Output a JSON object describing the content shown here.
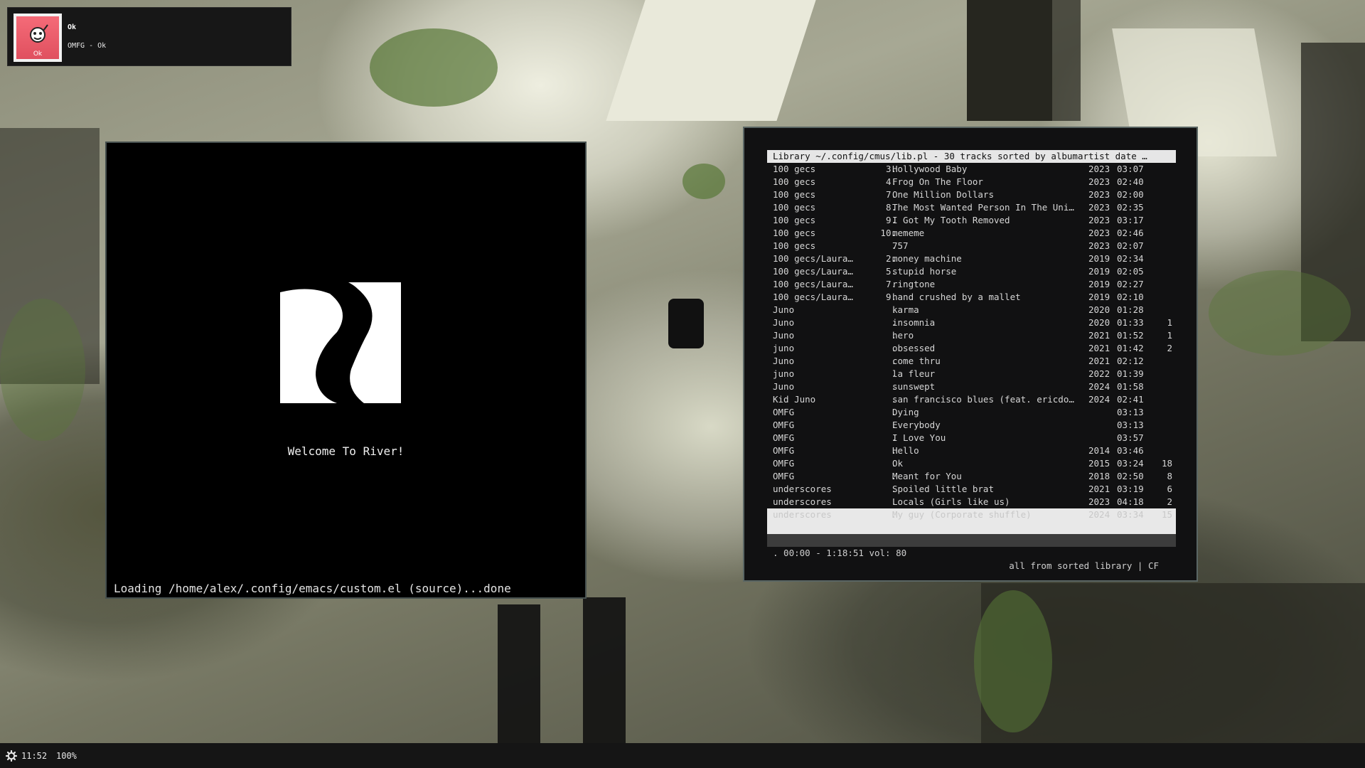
{
  "notification": {
    "icon": "album-cover-icon",
    "cover_text": "Ok",
    "title": "Ok",
    "body": "OMFG - Ok"
  },
  "emacs": {
    "logo": "river-logo-icon",
    "welcome": "Welcome To River!",
    "echo_area": "Loading /home/alex/.config/emacs/custom.el (source)...done"
  },
  "cmus": {
    "title": "Library ~/.config/cmus/lib.pl - 30 tracks sorted by albumartist date …",
    "tracks": [
      {
        "artist": "100 gecs",
        "num": "3.",
        "title": "Hollywood Baby",
        "year": "2023",
        "duration": "03:07",
        "plays": ""
      },
      {
        "artist": "100 gecs",
        "num": "4.",
        "title": "Frog On The Floor",
        "year": "2023",
        "duration": "02:40",
        "plays": ""
      },
      {
        "artist": "100 gecs",
        "num": "7.",
        "title": "One Million Dollars",
        "year": "2023",
        "duration": "02:00",
        "plays": ""
      },
      {
        "artist": "100 gecs",
        "num": "8.",
        "title": "The Most Wanted Person In The Uni…",
        "year": "2023",
        "duration": "02:35",
        "plays": ""
      },
      {
        "artist": "100 gecs",
        "num": "9.",
        "title": "I Got My Tooth Removed",
        "year": "2023",
        "duration": "03:17",
        "plays": ""
      },
      {
        "artist": "100 gecs",
        "num": "10.",
        "title": "mememe",
        "year": "2023",
        "duration": "02:46",
        "plays": ""
      },
      {
        "artist": "100 gecs",
        "num": ".",
        "title": "757",
        "year": "2023",
        "duration": "02:07",
        "plays": ""
      },
      {
        "artist": "100 gecs/Laura…",
        "num": "2.",
        "title": "money machine",
        "year": "2019",
        "duration": "02:34",
        "plays": ""
      },
      {
        "artist": "100 gecs/Laura…",
        "num": "5.",
        "title": "stupid horse",
        "year": "2019",
        "duration": "02:05",
        "plays": ""
      },
      {
        "artist": "100 gecs/Laura…",
        "num": "7.",
        "title": "ringtone",
        "year": "2019",
        "duration": "02:27",
        "plays": ""
      },
      {
        "artist": "100 gecs/Laura…",
        "num": "9.",
        "title": "hand crushed by a mallet",
        "year": "2019",
        "duration": "02:10",
        "plays": ""
      },
      {
        "artist": "Juno",
        "num": ".",
        "title": "karma",
        "year": "2020",
        "duration": "01:28",
        "plays": ""
      },
      {
        "artist": "Juno",
        "num": ".",
        "title": "insomnia",
        "year": "2020",
        "duration": "01:33",
        "plays": "1"
      },
      {
        "artist": "Juno",
        "num": ".",
        "title": "hero",
        "year": "2021",
        "duration": "01:52",
        "plays": "1"
      },
      {
        "artist": "juno",
        "num": ".",
        "title": "obsessed",
        "year": "2021",
        "duration": "01:42",
        "plays": "2"
      },
      {
        "artist": "Juno",
        "num": ".",
        "title": "come thru",
        "year": "2021",
        "duration": "02:12",
        "plays": ""
      },
      {
        "artist": "juno",
        "num": ".",
        "title": "la fleur",
        "year": "2022",
        "duration": "01:39",
        "plays": ""
      },
      {
        "artist": "Juno",
        "num": ".",
        "title": "sunswept",
        "year": "2024",
        "duration": "01:58",
        "plays": ""
      },
      {
        "artist": "Kid Juno",
        "num": ".",
        "title": "san francisco blues (feat. ericdo…",
        "year": "2024",
        "duration": "02:41",
        "plays": ""
      },
      {
        "artist": "OMFG",
        "num": ".",
        "title": "Dying",
        "year": "",
        "duration": "03:13",
        "plays": ""
      },
      {
        "artist": "OMFG",
        "num": ".",
        "title": "Everybody",
        "year": "",
        "duration": "03:13",
        "plays": ""
      },
      {
        "artist": "OMFG",
        "num": ".",
        "title": "I Love You",
        "year": "",
        "duration": "03:57",
        "plays": ""
      },
      {
        "artist": "OMFG",
        "num": ".",
        "title": "Hello",
        "year": "2014",
        "duration": "03:46",
        "plays": ""
      },
      {
        "artist": "OMFG",
        "num": ".",
        "title": "Ok",
        "year": "2015",
        "duration": "03:24",
        "plays": "18"
      },
      {
        "artist": "OMFG",
        "num": ".",
        "title": "Meant for You",
        "year": "2018",
        "duration": "02:50",
        "plays": "8"
      },
      {
        "artist": "underscores",
        "num": ".",
        "title": "Spoiled little brat",
        "year": "2021",
        "duration": "03:19",
        "plays": "6"
      },
      {
        "artist": "underscores",
        "num": ".",
        "title": "Locals (Girls like us)",
        "year": "2023",
        "duration": "04:18",
        "plays": "2"
      },
      {
        "artist": "underscores",
        "num": ".",
        "title": "My guy (Corporate shuffle)",
        "year": "2024",
        "duration": "03:34",
        "plays": "15",
        "selected": true
      }
    ],
    "status_left": ". 00:00 - 1:18:51 vol: 80",
    "status_right": "all from sorted library | CF"
  },
  "statusbar": {
    "icon": "gear-icon",
    "time": "11:52",
    "volume": "100%"
  }
}
